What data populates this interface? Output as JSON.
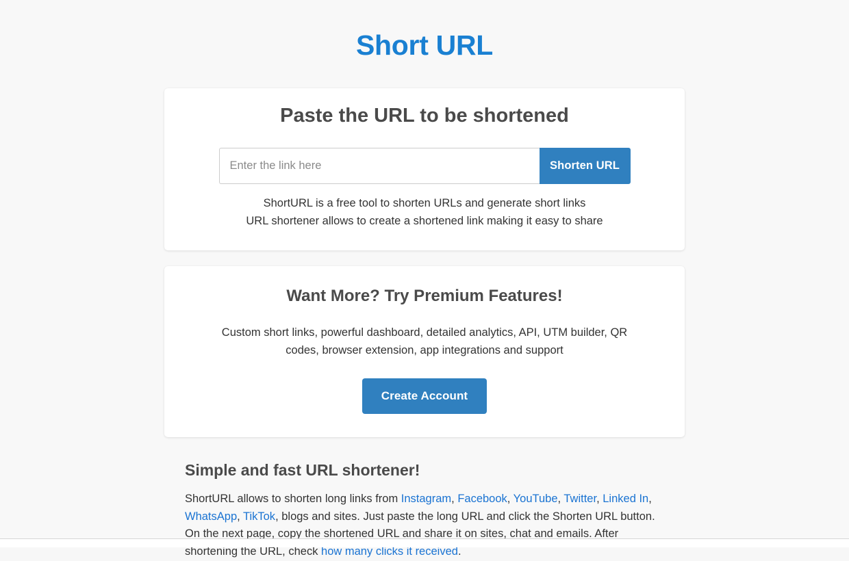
{
  "site": {
    "title": "Short URL",
    "title_color": "#1a80d2",
    "background_color": "#f8f8f8"
  },
  "shorten_card": {
    "heading": "Paste the URL to be shortened",
    "input": {
      "placeholder": "Enter the link here",
      "value": ""
    },
    "submit_label": "Shorten URL",
    "submit_color": "#3080bf",
    "note_line1": "ShortURL is a free tool to shorten URLs and generate short links",
    "note_line2": "URL shortener allows to create a shortened link making it easy to share"
  },
  "premium_card": {
    "heading": "Want More? Try Premium Features!",
    "description": "Custom short links, powerful dashboard, detailed analytics, API, UTM builder, QR codes, browser extension, app integrations and support",
    "cta_label": "Create Account",
    "cta_color": "#3080bf"
  },
  "article": {
    "heading": "Simple and fast URL shortener!",
    "text_1": "ShortURL allows to shorten long links from ",
    "link_instagram": "Instagram",
    "sep_1": ", ",
    "link_facebook": "Facebook",
    "sep_2": ", ",
    "link_youtube": "YouTube",
    "sep_3": ", ",
    "link_twitter": "Twitter",
    "sep_4": ", ",
    "link_linkedin": "Linked In",
    "sep_5": ", ",
    "link_whatsapp": "WhatsApp",
    "sep_6": ", ",
    "link_tiktok": "TikTok",
    "text_2": ", blogs and sites. Just paste the long URL and click the Shorten URL button. On the next page, copy the shortened URL and share it on sites, chat and emails. After shortening the URL, check ",
    "link_clicks": "how many clicks it received",
    "text_3": ".",
    "link_color": "#1a73d2"
  }
}
